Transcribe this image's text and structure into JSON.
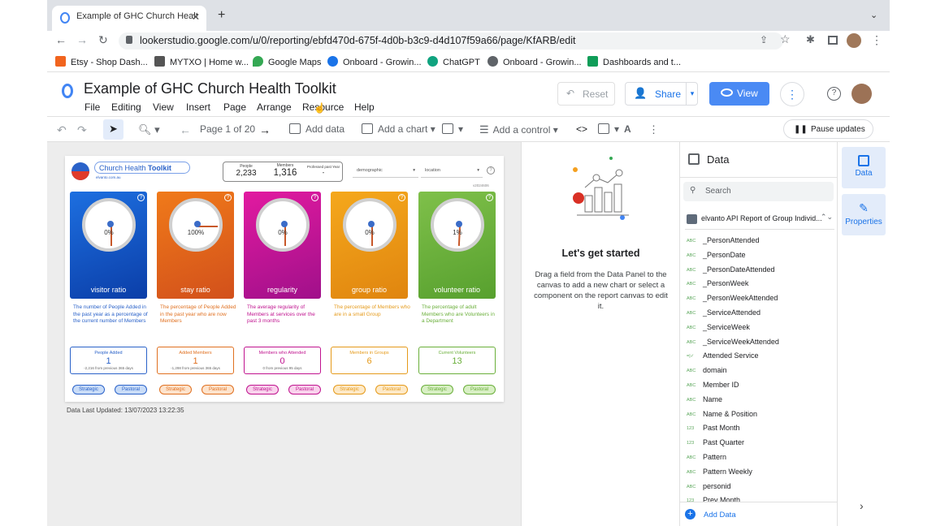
{
  "browser": {
    "tab_title": "Example of GHC Church Healt",
    "url": "lookerstudio.google.com/u/0/reporting/ebfd470d-675f-4d0b-b3c9-d4d107f59a66/page/KfARB/edit",
    "bookmarks": [
      {
        "label": "Etsy - Shop Dash...",
        "color": "#f1641e"
      },
      {
        "label": "MYTXO | Home w...",
        "color": "#555555"
      },
      {
        "label": "Google Maps",
        "color": "#34a853"
      },
      {
        "label": "Onboard - Growin...",
        "color": "#1a73e8"
      },
      {
        "label": "ChatGPT",
        "color": "#10a37f"
      },
      {
        "label": "Onboard - Growin...",
        "color": "#5f6368"
      },
      {
        "label": "Dashboards and t...",
        "color": "#0f9d58"
      }
    ]
  },
  "app": {
    "title": "Example of GHC Church Health Toolkit",
    "menu": [
      "File",
      "Editing",
      "View",
      "Insert",
      "Page",
      "Arrange",
      "Resource",
      "Help"
    ],
    "reset_label": "Reset",
    "share_label": "Share",
    "view_label": "View"
  },
  "toolbar": {
    "page_label": "Page 1 of 20",
    "add_data": "Add data",
    "add_chart": "Add a chart",
    "add_control": "Add a control",
    "pause_updates": "Pause updates"
  },
  "report": {
    "logo_text_a": "Church Health",
    "logo_text_b": "Toolkit",
    "logo_sub": "elvanto.com.au",
    "kpi_people_label": "People",
    "kpi_people_value": "2,233",
    "kpi_members_label": "Members",
    "kpi_members_value": "1,316",
    "kpi_professed_label": "Professed past Year",
    "kpi_professed_value": "-",
    "filter_demographic": "demographic",
    "filter_location": "location",
    "version": "v2024606",
    "cards": [
      {
        "name": "visitor ratio",
        "pct": "0%",
        "level": 0.0,
        "color1": "#1d6fe0",
        "color2": "#0b3ea8",
        "desc": "The number of People Added in the past year as a percentage of the current number of Members",
        "desc_color": "#2a62c9",
        "stat_label": "People Added",
        "stat_value": "1",
        "stat_sub": "-2,216 from previous 365 days",
        "stat_color": "#2a62c9",
        "pill1": "Strategic",
        "pill2": "Pastoral",
        "pill_bg": "#c9dcf7",
        "pill_border": "#2a62c9"
      },
      {
        "name": "stay ratio",
        "pct": "100%",
        "level": 1.0,
        "color1": "#f07a1a",
        "color2": "#d2501b",
        "desc": "The percentage of People Added in the past year who are now Members",
        "desc_color": "#e07020",
        "stat_label": "Added Members",
        "stat_value": "1",
        "stat_sub": "-1,298 from previous 365 days",
        "stat_color": "#e07020",
        "pill1": "Strategic",
        "pill2": "Pastoral",
        "pill_bg": "#fde3cc",
        "pill_border": "#e07020"
      },
      {
        "name": "regularity",
        "pct": "0%",
        "level": 0.0,
        "color1": "#e21aa0",
        "color2": "#a0108a",
        "desc": "The average regularity of Members at services over the past 3 months",
        "desc_color": "#c0138f",
        "stat_label": "Members who Attended",
        "stat_value": "0",
        "stat_sub": "0 from previous 95 days",
        "stat_color": "#c0138f",
        "pill1": "Strategic",
        "pill2": "Pastoral",
        "pill_bg": "#f9d2ec",
        "pill_border": "#c0138f"
      },
      {
        "name": "group ratio",
        "pct": "0%",
        "level": 0.0,
        "color1": "#f5a81c",
        "color2": "#e0850f",
        "desc": "The percentage of Members who are in a small Group",
        "desc_color": "#e59a1a",
        "stat_label": "Members in Groups",
        "stat_value": "6",
        "stat_sub": "",
        "stat_color": "#e59a1a",
        "pill1": "Strategic",
        "pill2": "Pastoral",
        "pill_bg": "#fde9c7",
        "pill_border": "#e59a1a"
      },
      {
        "name": "volunteer ratio",
        "pct": "1%",
        "level": 0.01,
        "color1": "#7fc04a",
        "color2": "#57a02e",
        "desc": "The percentage of adult Members who are Volunteers in a Department",
        "desc_color": "#6aaf3a",
        "stat_label": "Current Volunteers",
        "stat_value": "13",
        "stat_sub": "",
        "stat_color": "#6aaf3a",
        "pill1": "Strategic",
        "pill2": "Pastoral",
        "pill_bg": "#d8efc4",
        "pill_border": "#6aaf3a"
      }
    ],
    "last_updated": "Data Last Updated: 13/07/2023 13:22:35"
  },
  "getting_started": {
    "title": "Let's get started",
    "body": "Drag a field from the Data Panel to the canvas to add a new chart or select a component on the report canvas to edit it."
  },
  "data_panel": {
    "title": "Data",
    "search_placeholder": "Search",
    "source": "elvanto API Report of Group Individ...",
    "fields": [
      {
        "type": "ABC",
        "name": "_PersonAttended"
      },
      {
        "type": "ABC",
        "name": "_PersonDate"
      },
      {
        "type": "ABC",
        "name": "_PersonDateAttended"
      },
      {
        "type": "ABC",
        "name": "_PersonWeek"
      },
      {
        "type": "ABC",
        "name": "_PersonWeekAttended"
      },
      {
        "type": "ABC",
        "name": "_ServiceAttended"
      },
      {
        "type": "ABC",
        "name": "_ServiceWeek"
      },
      {
        "type": "ABC",
        "name": "_ServiceWeekAttended"
      },
      {
        "type": "=|✓",
        "name": "Attended Service"
      },
      {
        "type": "ABC",
        "name": "domain"
      },
      {
        "type": "ABC",
        "name": "Member ID"
      },
      {
        "type": "ABC",
        "name": "Name"
      },
      {
        "type": "ABC",
        "name": "Name & Position"
      },
      {
        "type": "123",
        "name": "Past Month"
      },
      {
        "type": "123",
        "name": "Past Quarter"
      },
      {
        "type": "ABC",
        "name": "Pattern"
      },
      {
        "type": "ABC",
        "name": "Pattern Weekly"
      },
      {
        "type": "ABC",
        "name": "personid"
      },
      {
        "type": "123",
        "name": "Prev Month"
      }
    ],
    "add_data": "Add Data"
  },
  "side_panel": {
    "data_label": "Data",
    "properties_label": "Properties"
  }
}
